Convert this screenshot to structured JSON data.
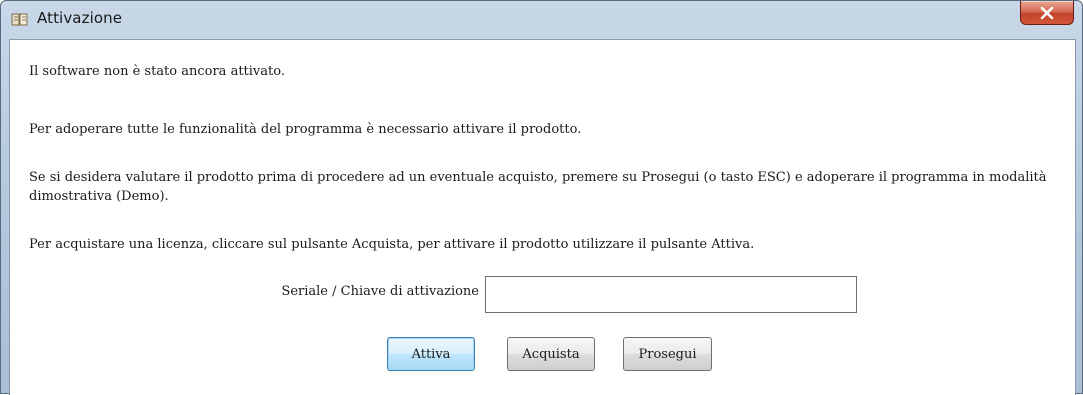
{
  "window": {
    "title": "Attivazione",
    "close_symbol": "×"
  },
  "messages": {
    "line1": "Il software non è stato ancora attivato.",
    "line2": "Per adoperare tutte le funzionalità del programma è necessario attivare il prodotto.",
    "line3": "Se si desidera valutare il prodotto prima di procedere ad un eventuale acquisto, premere su Prosegui (o tasto ESC) e adoperare il programma in modalità dimostrativa (Demo).",
    "line4": "Per acquistare una licenza, cliccare sul pulsante Acquista, per attivare il prodotto utilizzare il pulsante Attiva."
  },
  "form": {
    "serial_label": "Seriale / Chiave di attivazione",
    "serial_value": ""
  },
  "buttons": {
    "activate": "Attiva",
    "buy": "Acquista",
    "continue": "Prosegui"
  },
  "icons": {
    "app": "app-icon",
    "close": "close-icon"
  },
  "colors": {
    "title_bar": "#b7cbe0",
    "close_button": "#c4432b",
    "default_button_border": "#3c7fb1"
  }
}
